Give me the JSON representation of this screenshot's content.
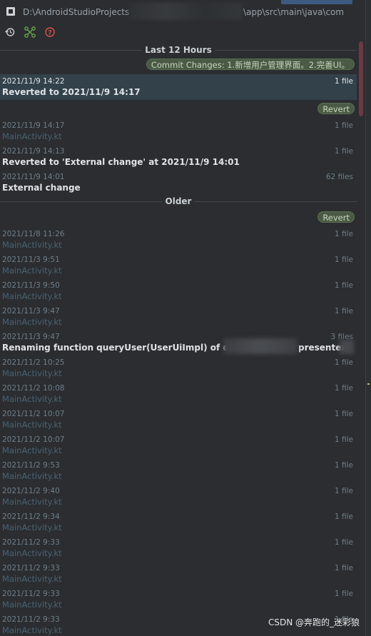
{
  "window": {
    "path_left": "D:\\AndroidStudioProjects",
    "path_right": "\\app\\src\\main\\java\\com"
  },
  "toolbar": {
    "icons": [
      "history-icon",
      "branch-compare-icon",
      "help-icon"
    ]
  },
  "sections": {
    "recent": "Last 12 Hours",
    "older": "Older"
  },
  "tags": {
    "commit": "Commit Changes: 1.新增用户管理界面。2.完善UI。",
    "revert1": "Revert",
    "revert2": "Revert"
  },
  "rows": [
    {
      "date": "2021/11/9 14:22",
      "title": "Reverted to 2021/11/9 14:17",
      "files": "1 file"
    },
    {
      "date": "2021/11/9 14:17",
      "name": "MainActivity.kt",
      "files": "1 file"
    },
    {
      "date": "2021/11/9 14:13",
      "title": "Reverted to 'External change' at 2021/11/9 14:01",
      "files": "1 file"
    },
    {
      "date": "2021/11/9 14:01",
      "title": "External change",
      "files": "62 files"
    },
    {
      "date": "2021/11/8 11:26",
      "name": "MainActivity.kt",
      "files": "1 file"
    },
    {
      "date": "2021/11/3 9:51",
      "name": "MainActivity.kt",
      "files": "1 file"
    },
    {
      "date": "2021/11/3 9:50",
      "name": "MainActivity.kt",
      "files": "1 file"
    },
    {
      "date": "2021/11/3 9:47",
      "name": "MainActivity.kt",
      "files": "1 file"
    },
    {
      "date": "2021/11/3 9:47",
      "title": "Renaming function queryUser(UserUiImpl) of com",
      "title_suffix": "presenter",
      "files": "3 files"
    },
    {
      "date": "2021/11/2 10:25",
      "name": "MainActivity.kt",
      "files": "1 file"
    },
    {
      "date": "2021/11/2 10:08",
      "name": "MainActivity.kt",
      "files": "1 file"
    },
    {
      "date": "2021/11/2 10:07",
      "name": "MainActivity.kt",
      "files": "1 file"
    },
    {
      "date": "2021/11/2 10:07",
      "name": "MainActivity.kt",
      "files": "1 file"
    },
    {
      "date": "2021/11/2 9:53",
      "name": "MainActivity.kt",
      "files": "1 file"
    },
    {
      "date": "2021/11/2 9:40",
      "name": "MainActivity.kt",
      "files": "1 file"
    },
    {
      "date": "2021/11/2 9:34",
      "name": "MainActivity.kt",
      "files": "1 file"
    },
    {
      "date": "2021/11/2 9:33",
      "name": "MainActivity.kt",
      "files": "1 file"
    },
    {
      "date": "2021/11/2 9:33",
      "name": "MainActivity.kt",
      "files": "1 file"
    },
    {
      "date": "2021/11/2 9:33",
      "name": "MainActivity.kt",
      "files": "1 file"
    },
    {
      "date": "2021/11/2 9:33",
      "name": "MainActivity.kt",
      "files": "1 file"
    }
  ],
  "watermark": "CSDN @奔跑的_迷彩狼",
  "colors": {
    "background": "#2b2d30",
    "selected_row": "#33414a",
    "tag_bg": "#4a5a45",
    "scrollbar": "#6b3a44"
  }
}
